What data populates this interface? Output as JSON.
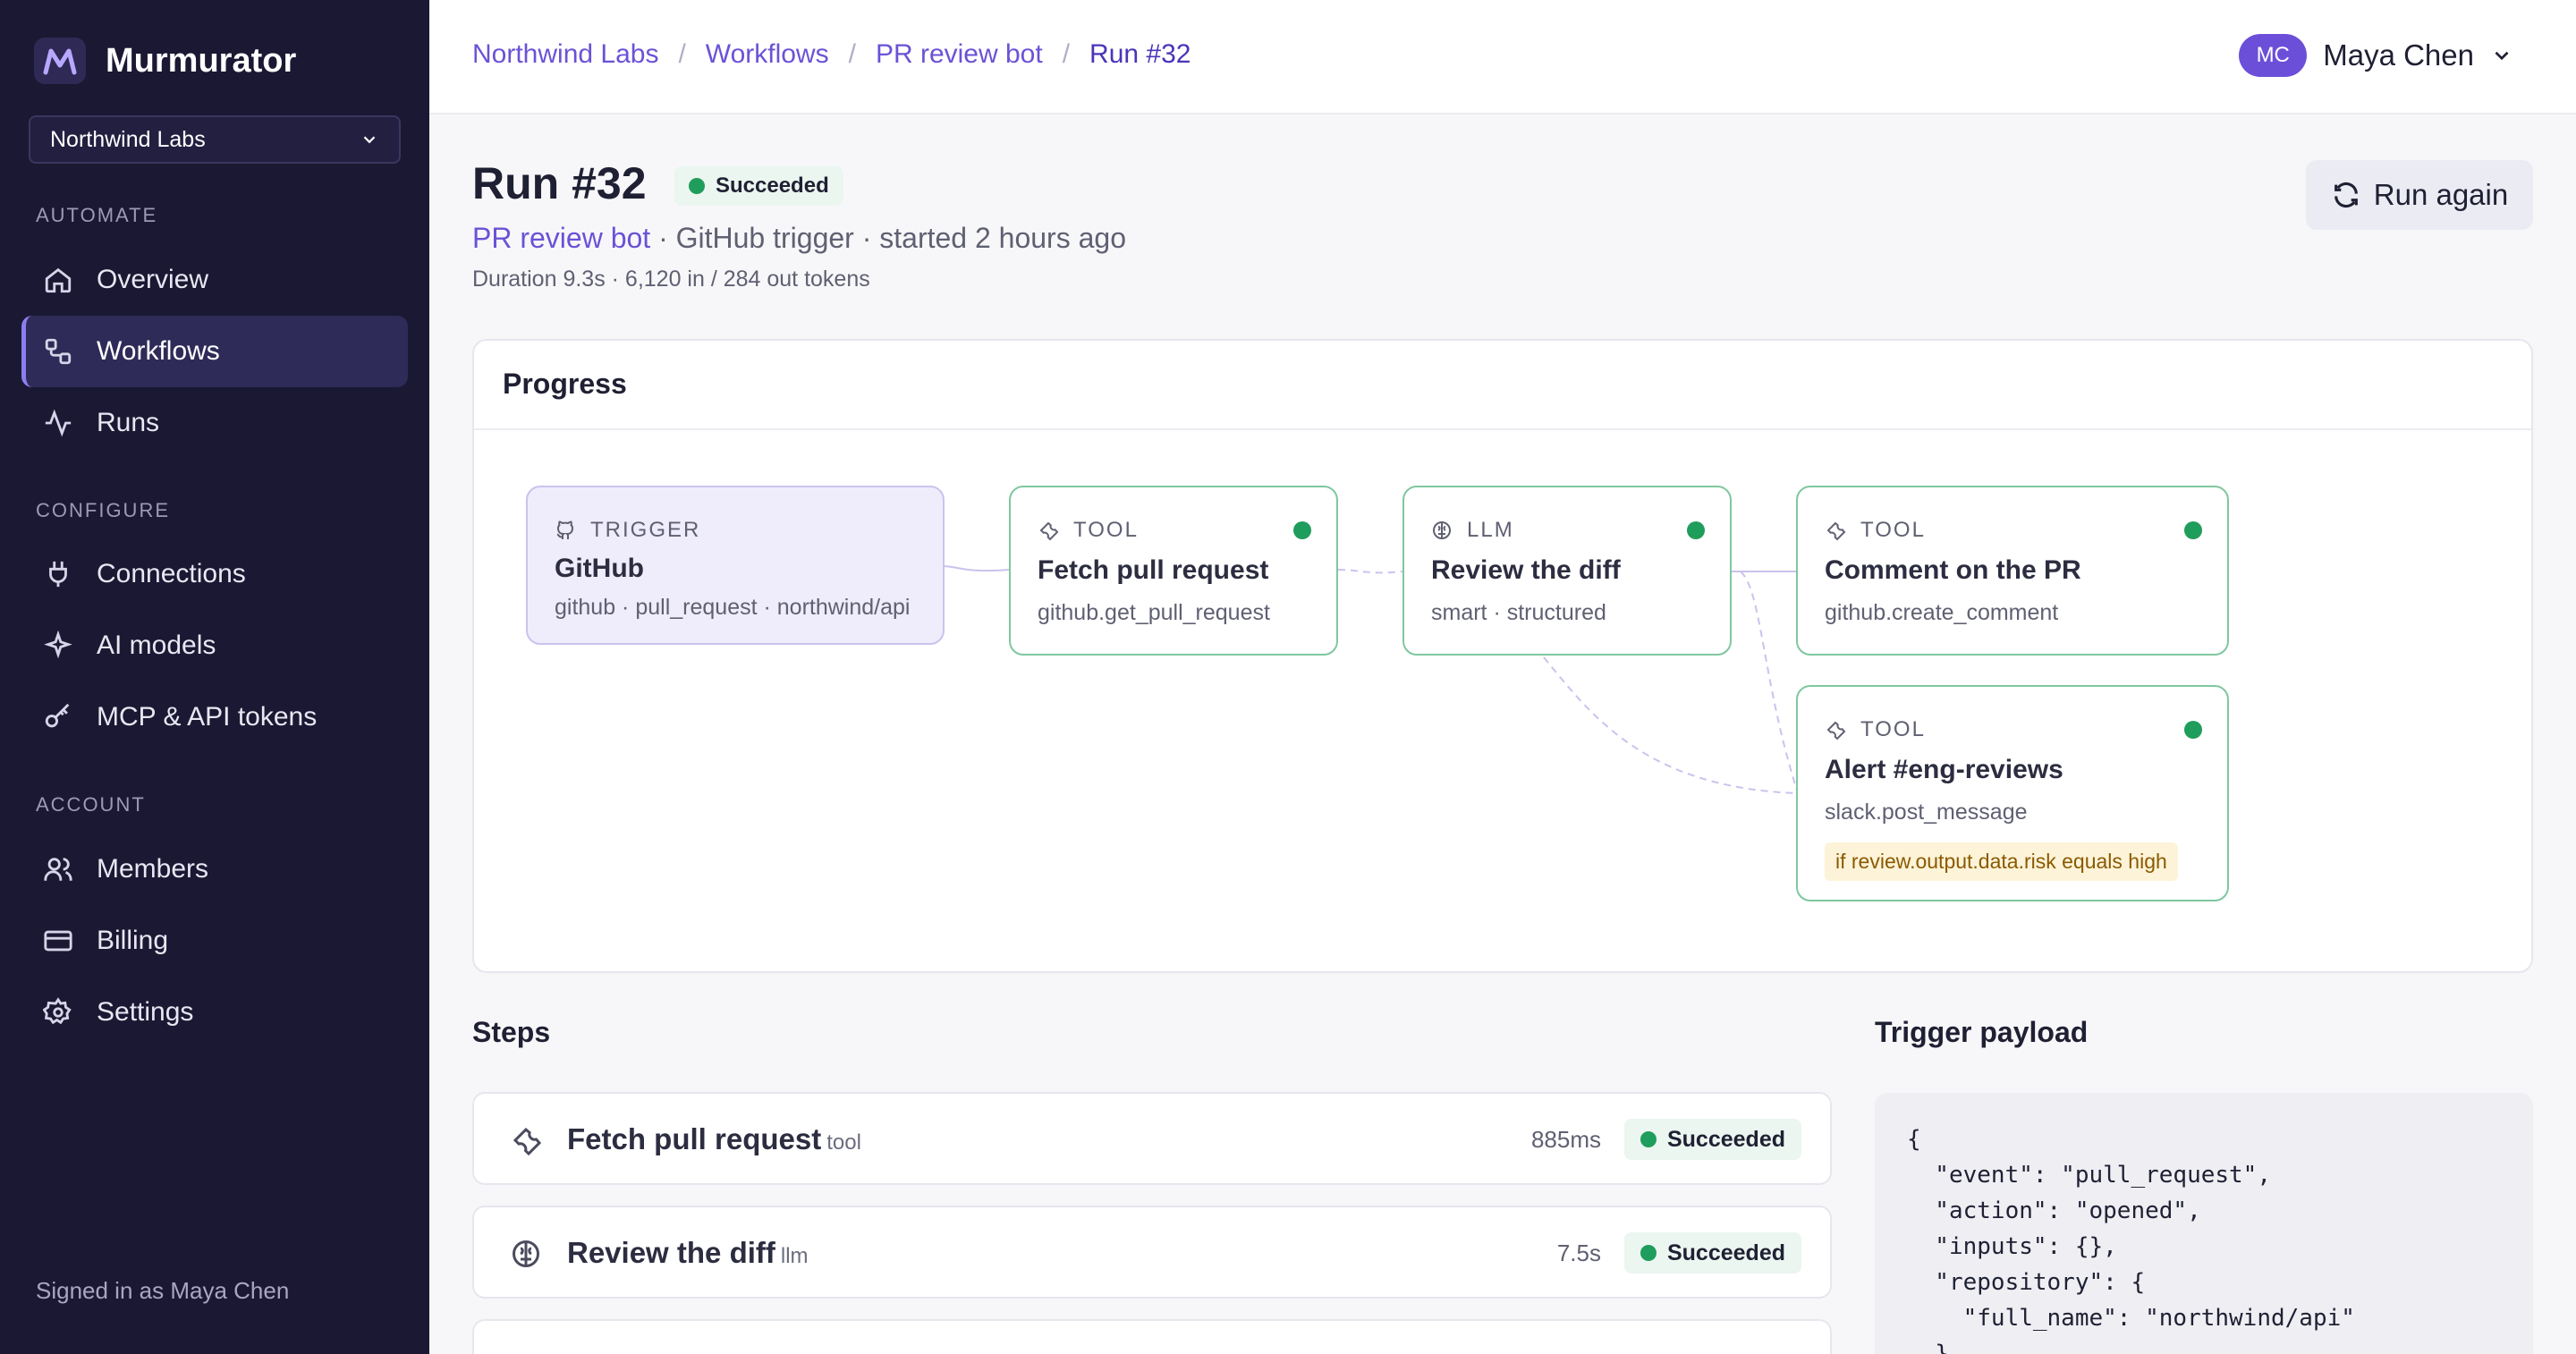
{
  "app": {
    "name": "Murmurator",
    "org": "Northwind Labs",
    "signed_in": "Signed in as Maya Chen"
  },
  "sidebar": {
    "sections": [
      {
        "label": "AUTOMATE"
      },
      {
        "label": "CONFIGURE"
      },
      {
        "label": "ACCOUNT"
      }
    ],
    "items": [
      {
        "label": "Overview",
        "icon": "home-icon"
      },
      {
        "label": "Workflows",
        "icon": "workflow-icon",
        "active": true
      },
      {
        "label": "Runs",
        "icon": "activity-icon"
      },
      {
        "label": "Connections",
        "icon": "plug-icon"
      },
      {
        "label": "AI models",
        "icon": "sparkle-icon"
      },
      {
        "label": "MCP & API tokens",
        "icon": "key-icon"
      },
      {
        "label": "Members",
        "icon": "users-icon"
      },
      {
        "label": "Billing",
        "icon": "credit-card-icon"
      },
      {
        "label": "Settings",
        "icon": "gear-icon"
      }
    ]
  },
  "breadcrumb": [
    "Northwind Labs",
    "Workflows",
    "PR review bot",
    "Run #32"
  ],
  "user": {
    "initials": "MC",
    "name": "Maya Chen"
  },
  "run": {
    "title": "Run #32",
    "status": "Succeeded",
    "workflow_link": "PR review bot",
    "subtitle_rest": " · GitHub trigger · started 2 hours ago",
    "meta": "Duration 9.3s · 6,120 in / 284 out tokens",
    "run_again_label": "Run again"
  },
  "progress": {
    "title": "Progress",
    "nodes": [
      {
        "kind": "TRIGGER",
        "name": "GitHub",
        "sub": "github · pull_request · northwind/api"
      },
      {
        "kind": "TOOL",
        "name": "Fetch pull request",
        "sub": "github.get_pull_request"
      },
      {
        "kind": "LLM",
        "name": "Review the diff",
        "sub": "smart · structured"
      },
      {
        "kind": "TOOL",
        "name": "Comment on the PR",
        "sub": "github.create_comment"
      },
      {
        "kind": "TOOL",
        "name": "Alert #eng-reviews",
        "sub": "slack.post_message",
        "condition": "if review.output.data.risk equals high"
      }
    ]
  },
  "steps": {
    "title": "Steps",
    "items": [
      {
        "name": "Fetch pull request",
        "type": "tool",
        "duration": "885ms",
        "status": "Succeeded"
      },
      {
        "name": "Review the diff",
        "type": "llm",
        "duration": "7.5s",
        "status": "Succeeded"
      }
    ]
  },
  "payload": {
    "title": "Trigger payload",
    "text": "{\n  \"event\": \"pull_request\",\n  \"action\": \"opened\",\n  \"inputs\": {},\n  \"repository\": {\n    \"full_name\": \"northwind/api\"\n  },"
  }
}
